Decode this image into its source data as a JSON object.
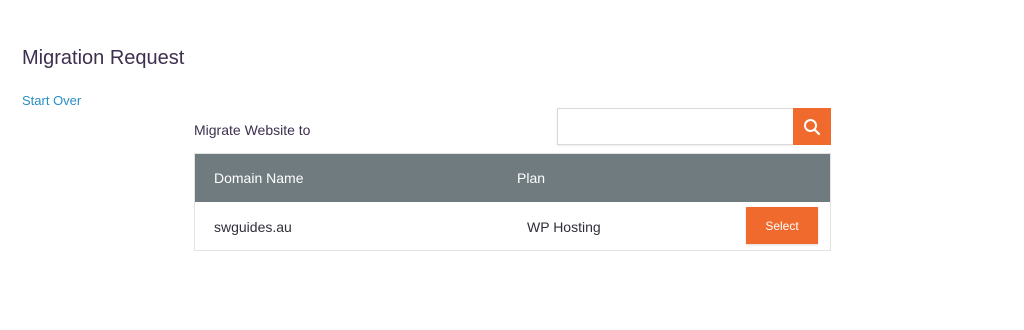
{
  "page": {
    "title": "Migration Request",
    "start_over": "Start Over"
  },
  "form": {
    "migrate_label": "Migrate Website to",
    "search": {
      "value": "",
      "placeholder": ""
    }
  },
  "table": {
    "headers": {
      "domain": "Domain Name",
      "plan": "Plan"
    },
    "rows": [
      {
        "domain": "swguides.au",
        "plan": "WP Hosting",
        "action": "Select"
      }
    ]
  },
  "colors": {
    "accent": "#ef6a2c",
    "header_bg": "#6f7b7e",
    "link": "#2a8fc4",
    "title": "#3d2f4f"
  },
  "icons": {
    "search": "search-icon"
  }
}
